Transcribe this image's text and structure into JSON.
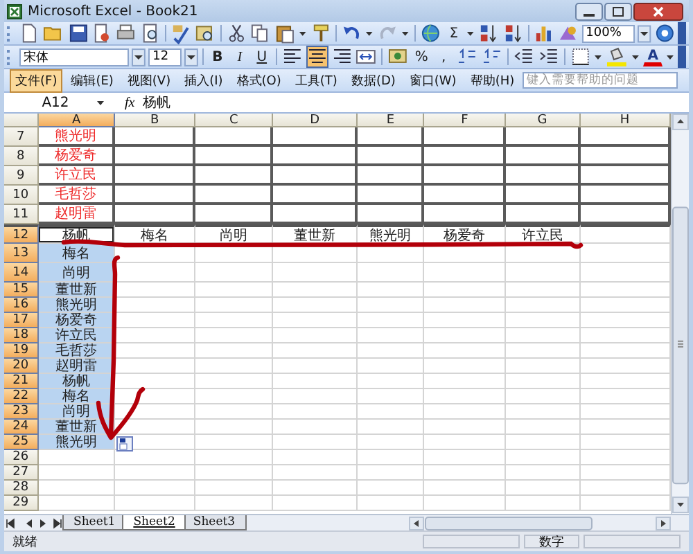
{
  "window": {
    "title": "Microsoft Excel - Book21"
  },
  "standard_toolbar": {
    "sum_button": "Σ",
    "zoom": "100%"
  },
  "formatting_toolbar": {
    "font": "宋体",
    "size": "12",
    "style_buttons": [
      {
        "label": "B",
        "kind": "bold"
      },
      {
        "label": "I",
        "kind": "italic"
      },
      {
        "label": "U",
        "kind": "underline"
      }
    ],
    "align_buttons": [
      {
        "kind": "left",
        "selected": false
      },
      {
        "kind": "center",
        "selected": true
      },
      {
        "kind": "right",
        "selected": false
      }
    ],
    "percent": "%",
    "comma": ",",
    "font_color_button": "A"
  },
  "menu": [
    {
      "label": "文件(F)",
      "selected": true
    },
    {
      "label": "编辑(E)",
      "selected": false
    },
    {
      "label": "视图(V)",
      "selected": false
    },
    {
      "label": "插入(I)",
      "selected": false
    },
    {
      "label": "格式(O)",
      "selected": false
    },
    {
      "label": "工具(T)",
      "selected": false
    },
    {
      "label": "数据(D)",
      "selected": false
    },
    {
      "label": "窗口(W)",
      "selected": false
    },
    {
      "label": "帮助(H)",
      "selected": false
    }
  ],
  "help_search": {
    "placeholder": "键入需要帮助的问题"
  },
  "formula_bar": {
    "name_box": "A12",
    "function_symbol": "fx",
    "formula": "杨帆"
  },
  "columns": [
    {
      "label": "A",
      "selected": true
    },
    {
      "label": "B",
      "selected": false
    },
    {
      "label": "C",
      "selected": false
    },
    {
      "label": "D",
      "selected": false
    },
    {
      "label": "E",
      "selected": false
    },
    {
      "label": "F",
      "selected": false
    },
    {
      "label": "G",
      "selected": false
    },
    {
      "label": "H",
      "selected": false
    }
  ],
  "rows": [
    {
      "number": "7",
      "kind": "boxed",
      "selected": false,
      "active": false,
      "cells": [
        "熊光明"
      ]
    },
    {
      "number": "8",
      "kind": "boxed",
      "selected": false,
      "active": false,
      "cells": [
        "杨爱奇"
      ]
    },
    {
      "number": "9",
      "kind": "boxed",
      "selected": false,
      "active": false,
      "cells": [
        "许立民"
      ]
    },
    {
      "number": "10",
      "kind": "boxed",
      "selected": false,
      "active": false,
      "cells": [
        "毛哲莎"
      ]
    },
    {
      "number": "11",
      "kind": "boxed",
      "selected": false,
      "active": false,
      "cells": [
        "赵明雷"
      ]
    },
    {
      "number": "12",
      "kind": "header",
      "selected": true,
      "active": true,
      "cells": [
        "杨帆",
        "梅名",
        "尚明",
        "董世新",
        "熊光明",
        "杨爱奇",
        "许立民"
      ]
    },
    {
      "number": "13",
      "kind": "plain",
      "selected": true,
      "active": false,
      "cells": [
        "梅名"
      ]
    },
    {
      "number": "14",
      "kind": "plain",
      "selected": true,
      "active": false,
      "cells": [
        "尚明"
      ]
    },
    {
      "number": "15",
      "kind": "plain",
      "selected": true,
      "active": false,
      "cells": [
        "董世新"
      ]
    },
    {
      "number": "16",
      "kind": "plain",
      "selected": true,
      "active": false,
      "cells": [
        "熊光明"
      ]
    },
    {
      "number": "17",
      "kind": "plain",
      "selected": true,
      "active": false,
      "cells": [
        "杨爱奇"
      ]
    },
    {
      "number": "18",
      "kind": "plain",
      "selected": true,
      "active": false,
      "cells": [
        "许立民"
      ]
    },
    {
      "number": "19",
      "kind": "plain",
      "selected": true,
      "active": false,
      "cells": [
        "毛哲莎"
      ]
    },
    {
      "number": "20",
      "kind": "plain",
      "selected": true,
      "active": false,
      "cells": [
        "赵明雷"
      ]
    },
    {
      "number": "21",
      "kind": "plain",
      "selected": true,
      "active": false,
      "cells": [
        "杨帆"
      ]
    },
    {
      "number": "22",
      "kind": "plain",
      "selected": true,
      "active": false,
      "cells": [
        "梅名"
      ]
    },
    {
      "number": "23",
      "kind": "plain",
      "selected": true,
      "active": false,
      "cells": [
        "尚明"
      ]
    },
    {
      "number": "24",
      "kind": "plain",
      "selected": true,
      "active": false,
      "cells": [
        "董世新"
      ]
    },
    {
      "number": "25",
      "kind": "plain",
      "selected": true,
      "active": false,
      "cells": [
        "熊光明"
      ]
    },
    {
      "number": "26",
      "kind": "plain",
      "selected": false,
      "active": false,
      "cells": []
    },
    {
      "number": "27",
      "kind": "plain",
      "selected": false,
      "active": false,
      "cells": []
    },
    {
      "number": "28",
      "kind": "plain",
      "selected": false,
      "active": false,
      "cells": []
    },
    {
      "number": "29",
      "kind": "plain",
      "selected": false,
      "active": false,
      "cells": []
    }
  ],
  "sheet_tabs": [
    {
      "label": "Sheet1",
      "selected": false
    },
    {
      "label": "Sheet2",
      "selected": true
    },
    {
      "label": "Sheet3",
      "selected": false
    }
  ],
  "status_bar": {
    "message": "就绪",
    "indicator": "数字"
  }
}
